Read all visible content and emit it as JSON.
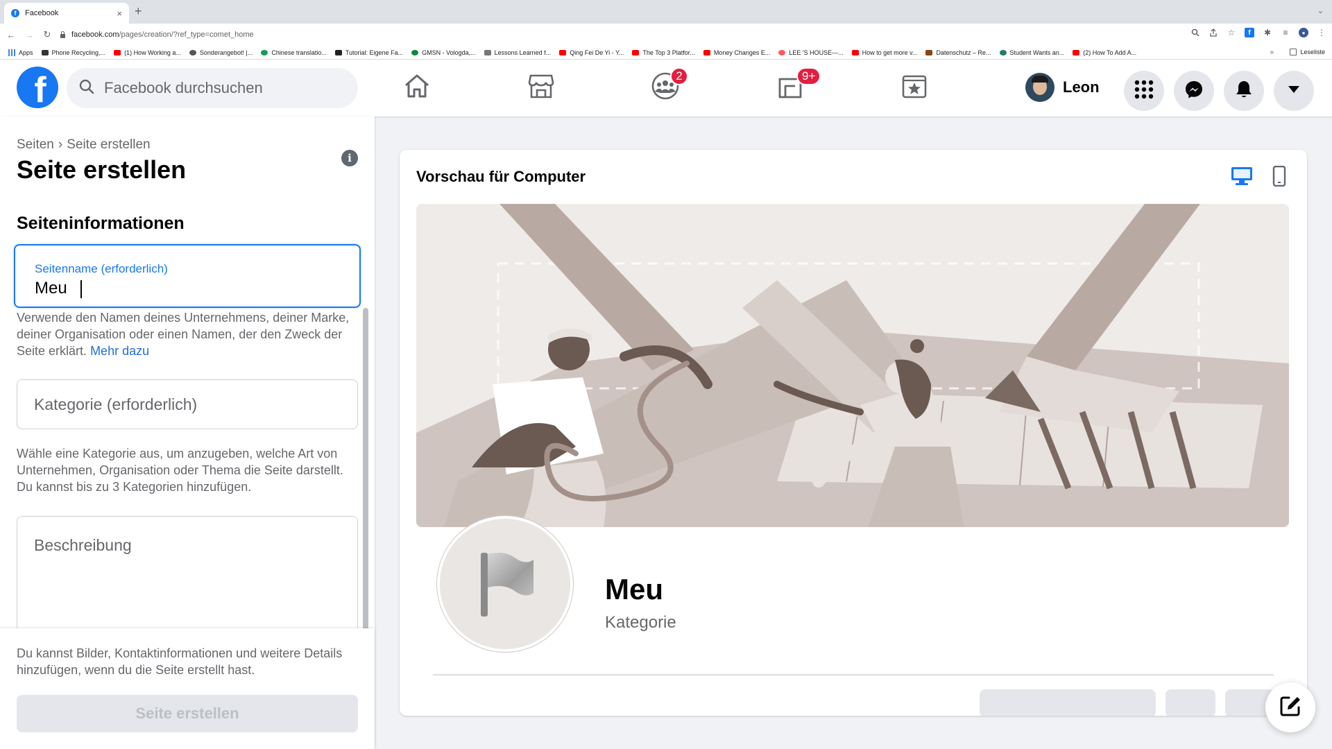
{
  "browser": {
    "tab_title": "Facebook",
    "tab_close": "×",
    "new_tab": "+",
    "url_host": "facebook.com",
    "url_path": "/pages/creation/?ref_type=comet_home",
    "bookmarks": [
      {
        "label": "Apps",
        "color": "#4285f4"
      },
      {
        "label": "Phone Recycling,...",
        "color": "#333333"
      },
      {
        "label": "(1) How Working a...",
        "color": "#ff0000"
      },
      {
        "label": "Sonderangebot! |...",
        "color": "#555555"
      },
      {
        "label": "Chinese translatio...",
        "color": "#0f9d58"
      },
      {
        "label": "Tutorial: Eigene Fa...",
        "color": "#222222"
      },
      {
        "label": "GMSN - Vologda,...",
        "color": "#0a8a3a"
      },
      {
        "label": "Lessons Learned f...",
        "color": "#777777"
      },
      {
        "label": "Qing Fei De Yi - Y...",
        "color": "#ff0000"
      },
      {
        "label": "The Top 3 Platfor...",
        "color": "#ff0000"
      },
      {
        "label": "Money Changes E...",
        "color": "#ff0000"
      },
      {
        "label": "LEE 'S HOUSE—...",
        "color": "#ff5a5f"
      },
      {
        "label": "How to get more v...",
        "color": "#ff0000"
      },
      {
        "label": "Datenschutz – Re...",
        "color": "#8b4513"
      },
      {
        "label": "Student Wants an...",
        "color": "#1a7f64"
      },
      {
        "label": "(2) How To Add A...",
        "color": "#ff0000"
      }
    ],
    "bookmarks_more": "»",
    "reading_list": "Leseliste"
  },
  "header": {
    "logo": "f",
    "search_placeholder": "Facebook durchsuchen",
    "groups_badge": "2",
    "gaming_badge": "9+",
    "profile_name": "Leon"
  },
  "left_panel": {
    "breadcrumb_root": "Seiten",
    "breadcrumb_sep": "›",
    "breadcrumb_current": "Seite erstellen",
    "title": "Seite erstellen",
    "info_icon": "i",
    "section_title": "Seiteninformationen",
    "name_field": {
      "label": "Seitenname (erforderlich)",
      "value": "Meu"
    },
    "name_help": "Verwende den Namen deines Unternehmens, deiner Marke, deiner Organisation oder einen Namen, der den Zweck der Seite erklärt.",
    "name_help_link": "Mehr dazu",
    "category_placeholder": "Kategorie (erforderlich)",
    "category_help": "Wähle eine Kategorie aus, um anzugeben, welche Art von Unternehmen, Organisation oder Thema die Seite darstellt. Du kannst bis zu 3 Kategorien hinzufügen.",
    "description_placeholder": "Beschreibung",
    "footer_help": "Du kannst Bilder, Kontaktinformationen und weitere Details hinzufügen, wenn du die Seite erstellt hast.",
    "create_button": "Seite erstellen"
  },
  "preview": {
    "title": "Vorschau für Computer",
    "page_name": "Meu",
    "category": "Kategorie",
    "active_device": "desktop"
  },
  "colors": {
    "brand": "#1877f2",
    "badge": "#e41e3f",
    "link": "#216fdb"
  },
  "icons": [
    "facebook-logo",
    "search-icon",
    "home-icon",
    "marketplace-icon",
    "groups-icon",
    "gaming-icon",
    "watch-icon",
    "menu-grid-icon",
    "messenger-icon",
    "notifications-icon",
    "account-caret-icon",
    "info-icon",
    "desktop-icon",
    "mobile-icon",
    "flag-icon",
    "compose-icon"
  ]
}
